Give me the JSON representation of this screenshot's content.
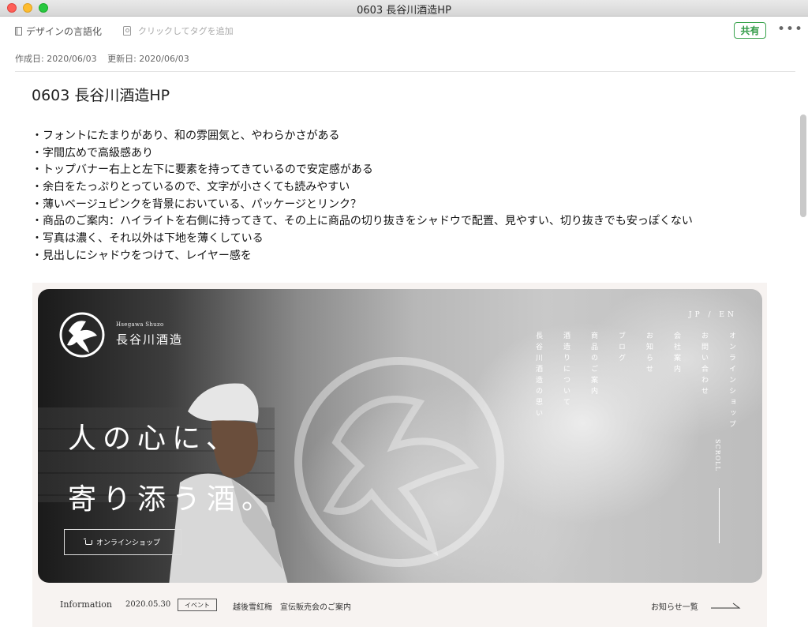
{
  "window": {
    "title": "0603 長谷川酒造HP"
  },
  "header": {
    "notebook": "デザインの言語化",
    "tag_placeholder": "クリックしてタグを追加",
    "share_label": "共有",
    "more_label": "•••"
  },
  "meta": {
    "created": "作成日: 2020/06/03",
    "updated": "更新日: 2020/06/03"
  },
  "note": {
    "title": "0603 長谷川酒造HP",
    "bullets": [
      "・フォントにたまりがあり、和の雰囲気と、やわらかさがある",
      "・字間広めで高級感あり",
      "・トップバナー右上と左下に要素を持ってきているので安定感がある",
      "・余白をたっぷりとっているので、文字が小さくても読みやすい",
      "・薄いベージュピンクを背景においている、パッケージとリンク？",
      "・商品のご案内：ハイライトを右側に持ってきて、その上に商品の切り抜きをシャドウで配置、見やすい、切り抜きでも安っぽくない",
      "・写真は濃く、それ以外は下地を薄くしている",
      "・見出しにシャドウをつけて、レイヤー感を"
    ]
  },
  "site": {
    "brand_small": "Hsegawa Shuzo",
    "brand_name": "長谷川酒造",
    "hero_line1": "人の心に、",
    "hero_line2": "寄り添う酒。",
    "shop_button": "オンラインショップ",
    "lang": "JP / EN",
    "nav": [
      "オンラインショップ",
      "お問い合わせ",
      "会社案内",
      "お知らせ",
      "ブログ",
      "商品のご案内",
      "酒造りについて",
      "長谷川酒造の思い"
    ],
    "scroll": "SCROLL",
    "info": {
      "label": "Information",
      "date": "2020.05.30",
      "tag": "イベント",
      "title": "越後雪紅梅　宣伝販売会のご案内",
      "more": "お知らせ一覧"
    }
  },
  "colors": {
    "share_green": "#2f9a44",
    "site_bg": "#f7f3f1"
  }
}
